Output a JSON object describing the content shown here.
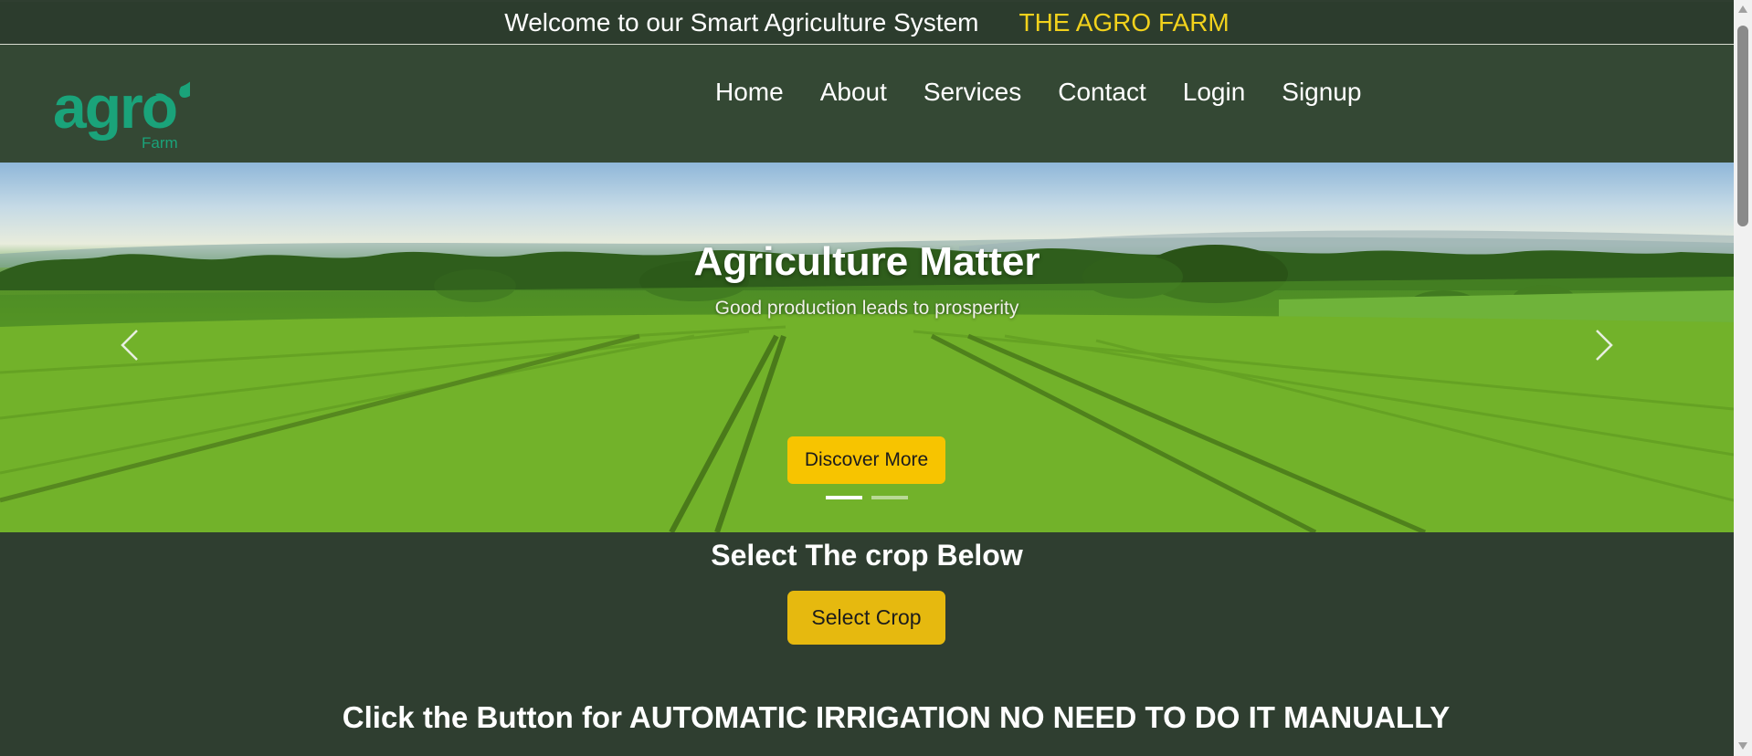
{
  "topbar": {
    "welcome": "Welcome to our Smart Agriculture System",
    "brand": "THE AGRO FARM"
  },
  "logo": {
    "word": "agro",
    "sub": "Farm",
    "color": "#1aa37a"
  },
  "nav": {
    "items": [
      {
        "label": "Home"
      },
      {
        "label": "About"
      },
      {
        "label": "Services"
      },
      {
        "label": "Contact"
      },
      {
        "label": "Login"
      },
      {
        "label": "Signup"
      }
    ]
  },
  "hero": {
    "title": "Agriculture Matter",
    "subtitle": "Good production leads to prosperity",
    "button_label": "Discover More",
    "prev_icon": "chevron-left-icon",
    "next_icon": "chevron-right-icon",
    "slides": 2,
    "active_slide": 1
  },
  "crop_section": {
    "title": "Select The crop Below",
    "button_label": "Select Crop"
  },
  "irrigation": {
    "text": "Click the Button for AUTOMATIC IRRIGATION NO NEED TO DO IT MANUALLY"
  },
  "colors": {
    "page_bg": "#2f3e30",
    "header_bg": "#344834",
    "accent_yellow": "#f7c400",
    "brand_yellow": "#f2d21c"
  }
}
